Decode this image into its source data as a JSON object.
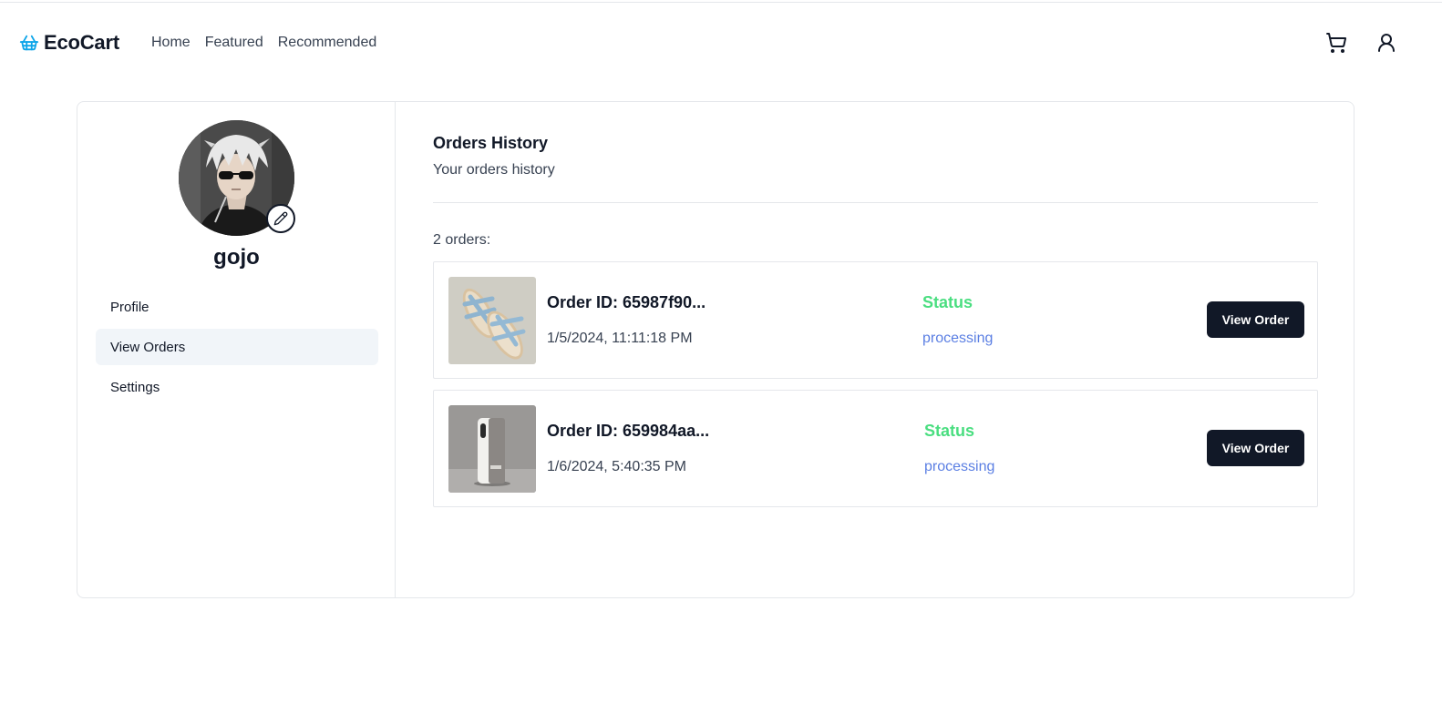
{
  "header": {
    "brand": "EcoCart",
    "brand_icon": "basket-icon",
    "brand_icon_color": "#0ea5e9",
    "nav": [
      "Home",
      "Featured",
      "Recommended"
    ],
    "icons": [
      "cart-icon",
      "user-icon"
    ]
  },
  "profile": {
    "avatar": "avatar",
    "edit_icon": "pencil-icon",
    "username": "gojo",
    "menu": [
      {
        "label": "Profile",
        "active": false
      },
      {
        "label": "View Orders",
        "active": true
      },
      {
        "label": "Settings",
        "active": false
      }
    ]
  },
  "orders": {
    "title": "Orders History",
    "subtitle": "Your orders history",
    "count_label": "2 orders:",
    "status_label_color": "#4ade80",
    "status_value_color": "#5b7fe3",
    "button_color": "#111827",
    "items": [
      {
        "thumbnail": "sandals-image",
        "order_id": "Order ID: 65987f90...",
        "date": "1/5/2024, 11:11:18 PM",
        "status_label": "Status",
        "status": "processing",
        "button": "View Order"
      },
      {
        "thumbnail": "phone-case-image",
        "order_id": "Order ID: 659984aa...",
        "date": "1/6/2024, 5:40:35 PM",
        "status_label": "Status",
        "status": "processing",
        "button": "View Order"
      }
    ]
  }
}
